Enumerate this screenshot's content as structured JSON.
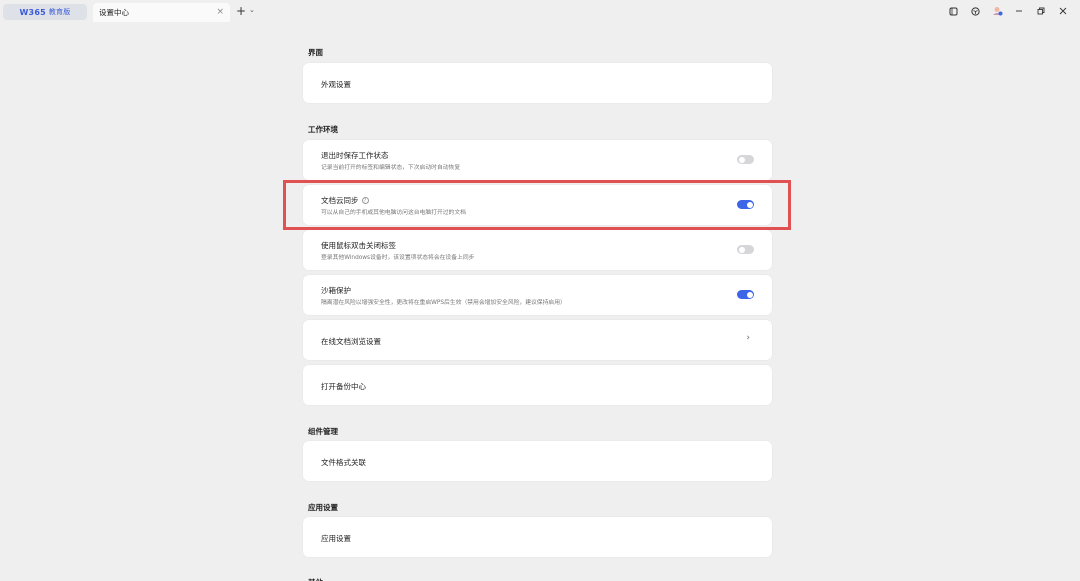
{
  "titlebar": {
    "app_logo": "W365",
    "app_name": "教育版",
    "doc_tab": "设置中心",
    "close_glyph": "×",
    "add_glyph": "+",
    "menu_glyph": "⌄"
  },
  "sections": [
    {
      "title": "界面"
    },
    {
      "title": "工作环境"
    },
    {
      "title": "组件管理"
    },
    {
      "title": "应用设置"
    },
    {
      "title": "其他"
    }
  ],
  "items": {
    "appearance": {
      "label": "外观设置"
    },
    "save_state": {
      "label": "退出时保存工作状态",
      "desc": "记录当前打开的标签和编辑状态，下次启动时自动恢复",
      "toggle": "off"
    },
    "cloud_sync": {
      "label": "文档云同步",
      "desc": "可以从自己的手机或其他电脑访问这台电脑打开过的文档",
      "toggle": "on"
    },
    "double_click_close": {
      "label": "使用鼠标双击关闭标签",
      "desc": "登录其他Windows设备时，该设置项状态将会在设备上同步",
      "toggle": "off"
    },
    "sandbox": {
      "label": "沙箱保护",
      "desc": "隔离潜在风险以增强安全性，更改将在重启WPS后生效（禁用会增加安全风险，建议保持启用）",
      "toggle": "on"
    },
    "online_browse": {
      "label": "在线文档浏览设置",
      "chevron": "›"
    },
    "backup_center": {
      "label": "打开备份中心"
    },
    "file_assoc": {
      "label": "文件格式关联"
    },
    "app_settings": {
      "label": "应用设置"
    }
  },
  "colors": {
    "accent": "#3c65e8",
    "highlight": "#e05252",
    "background": "#efeff0"
  }
}
